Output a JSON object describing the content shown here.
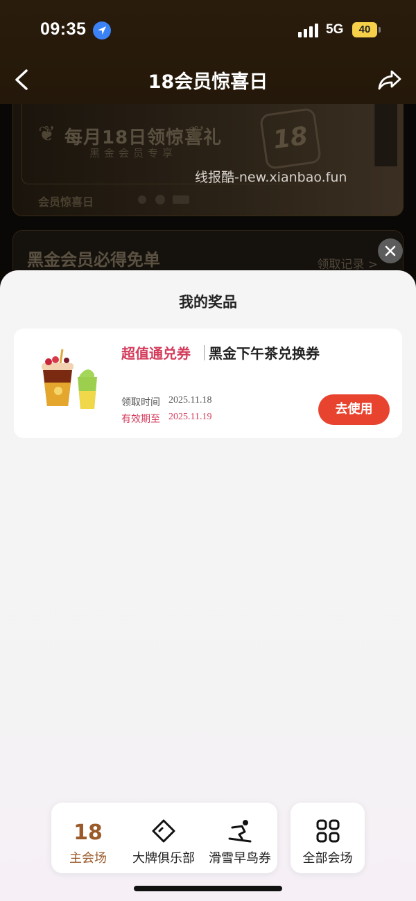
{
  "status_bar": {
    "time": "09:35",
    "network": "5G",
    "battery": "40"
  },
  "nav": {
    "title": "18会员惊喜日",
    "back_icon": "back-arrow-icon",
    "share_icon": "share-icon"
  },
  "background": {
    "banner_heading": "每月18日领惊喜礼",
    "banner_sub": "黑金会员专享",
    "badge_text": "18",
    "watermark": "线报酷-new.xianbao.fun",
    "banner_footer": "会员惊喜日",
    "section_title": "黑金会员必得免单",
    "section_link": "领取记录 >"
  },
  "sheet": {
    "title": "我的奖品",
    "prize": {
      "type_label": "超值通兑券",
      "name": "黑金下午茶兑换券",
      "claim_label": "领取时间",
      "claim_date": "2025.11.18",
      "expire_label": "有效期至",
      "expire_date": "2025.11.19",
      "use_button": "去使用"
    }
  },
  "tabbar": {
    "items": [
      {
        "label": "主会场",
        "icon": "eighteen-logo-icon",
        "active": true
      },
      {
        "label": "大牌俱乐部",
        "icon": "diamond-tag-icon",
        "active": false
      },
      {
        "label": "滑雪早鸟券",
        "icon": "skier-icon",
        "active": false
      }
    ],
    "all": {
      "label": "全部会场",
      "icon": "grid-icon"
    }
  },
  "colors": {
    "accent_red": "#e8432f",
    "pink_text": "#d43c5c",
    "active_tab": "#9a5a2a",
    "header_bg": "#2a1c0c"
  }
}
